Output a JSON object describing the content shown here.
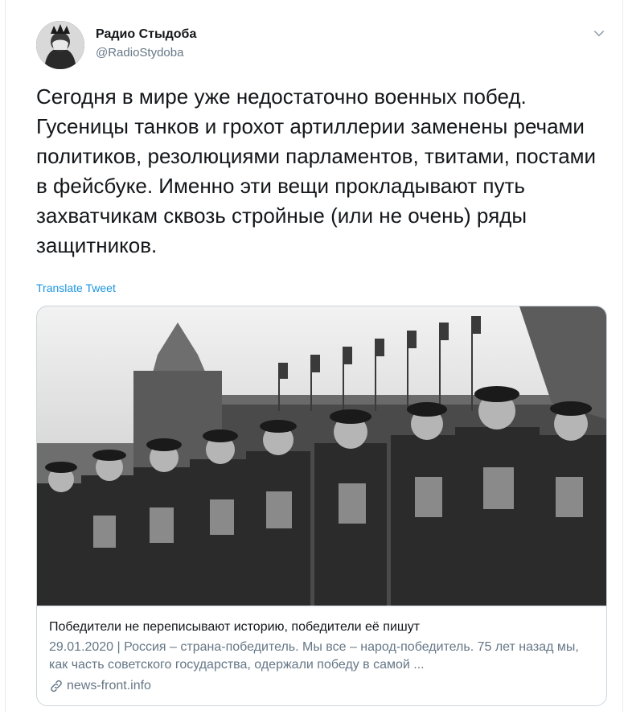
{
  "author": {
    "display_name": "Радио Стыдоба",
    "handle": "@RadioStydoba"
  },
  "icons": {
    "menu": "chevron-down-icon",
    "link": "link-icon"
  },
  "tweet": {
    "text": "Сегодня в мире уже недостаточно военных побед. Гусеницы танков и грохот артиллерии заменены речами политиков, резолюциями парламентов, твитами, постами в фейсбуке. Именно эти вещи прокладывают путь захватчикам сквозь стройные (или не очень) ряды защитников.",
    "translate_label": "Translate Tweet"
  },
  "card": {
    "title": "Победители не переписывают историю, победители её пишут",
    "description": "29.01.2020 | Россия – страна-победитель. Мы все – народ-победитель. 75 лет назад мы, как часть советского государства, одержали победу в самой ...",
    "domain": "news-front.info"
  },
  "colors": {
    "link_blue": "#1b95e0",
    "secondary_text": "#657786",
    "border": "#ccd6dd"
  }
}
